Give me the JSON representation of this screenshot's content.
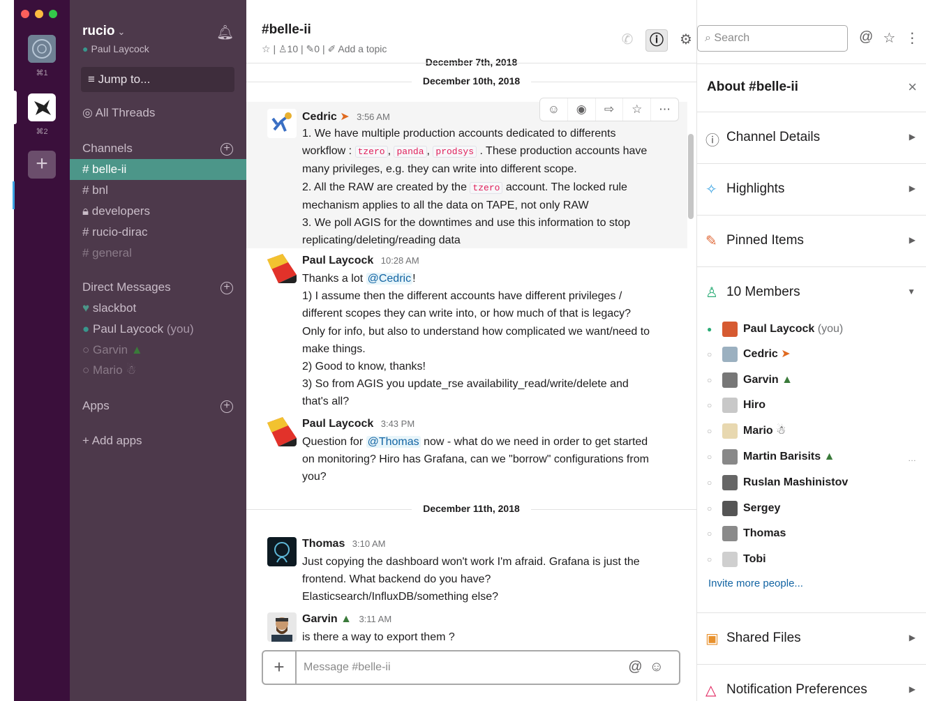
{
  "workspace": {
    "name": "rucio",
    "user": "Paul Laycock",
    "shortcut_1": "⌘1",
    "shortcut_2": "⌘2",
    "jump_to": "Jump to...",
    "all_threads": "All Threads"
  },
  "sidebar": {
    "channels_header": "Channels",
    "channels": [
      "# belle-ii",
      "# bnl",
      "developers",
      "# rucio-dirac",
      "# general"
    ],
    "dm_header": "Direct Messages",
    "dms": [
      "slackbot",
      "Paul Laycock",
      "(you)",
      "Garvin",
      "Mario"
    ],
    "apps_header": "Apps",
    "add_apps": "+ Add apps"
  },
  "channel": {
    "title": "#belle-ii",
    "members_count": "10",
    "pins_count": "0",
    "add_topic": "Add a topic"
  },
  "days": {
    "d1": "December 7th, 2018",
    "d2": "December 10th, 2018",
    "d3": "December 11th, 2018"
  },
  "messages": [
    {
      "author": "Cedric",
      "time": "3:56 AM",
      "lines": {
        "l1": "1. We have multiple production accounts dedicated to differents",
        "l2a": "workflow : ",
        "c1": "tzero",
        "c2": "panda",
        "c3": "prodsys",
        "l2b": ". These production accounts have",
        "l3": "many privileges, e.g. they can write into different scope.",
        "l4a": "2. All the RAW are created by the ",
        "c4": "tzero",
        "l4b": " account. The locked rule",
        "l5": "mechanism applies to all the data on TAPE, not only RAW",
        "l6": "3. We poll AGIS for the downtimes and use this information to stop",
        "l7": "replicating/deleting/reading data"
      }
    },
    {
      "author": "Paul Laycock",
      "time": "10:28 AM",
      "lines": {
        "l1a": "Thanks a lot ",
        "mention": "@Cedric",
        "l1b": "!",
        "l2": "1) I assume then the different accounts have different privileges /",
        "l3": "different scopes they can write into, or how much of that is legacy?",
        "l4": "Only for info, but also to understand how complicated we want/need to",
        "l5": "make things.",
        "l6": "2) Good to know, thanks!",
        "l7": "3) So from AGIS you update_rse availability_read/write/delete and",
        "l8": "that's all?"
      }
    },
    {
      "author": "Paul Laycock",
      "time": "3:43 PM",
      "lines": {
        "l1a": "Question for ",
        "mention": "@Thomas",
        "l1b": " now - what do we need in order to get started",
        "l2": "on monitoring?  Hiro has Grafana, can we \"borrow\" configurations from",
        "l3": "you?"
      }
    },
    {
      "author": "Thomas",
      "time": "3:10 AM",
      "lines": {
        "l1": "Just copying the dashboard won't work I'm afraid. Grafana is just the",
        "l2": "frontend. What backend do you have?",
        "l3": "Elasticsearch/InfluxDB/something else?"
      }
    },
    {
      "author": "Garvin",
      "time": "3:11 AM",
      "lines": {
        "l1": "is there a way to export them ?"
      }
    }
  ],
  "composer": {
    "placeholder": "Message #belle-ii"
  },
  "right_panel": {
    "search_placeholder": "Search",
    "title": "About #belle-ii",
    "sections": [
      "Channel Details",
      "Highlights",
      "Pinned Items",
      "10 Members",
      "Shared Files",
      "Notification Preferences"
    ],
    "members": [
      {
        "name": "Paul Laycock",
        "suffix": "(you)",
        "color": "#d65a31"
      },
      {
        "name": "Cedric",
        "suffix": "",
        "color": "#9bb0c0"
      },
      {
        "name": "Garvin",
        "suffix": "",
        "color": "#777777"
      },
      {
        "name": "Hiro",
        "suffix": "",
        "color": "#c8c8c8"
      },
      {
        "name": "Mario",
        "suffix": "",
        "color": "#e8d8b0"
      },
      {
        "name": "Martin Barisits",
        "suffix": "",
        "color": "#888888"
      },
      {
        "name": "Ruslan Mashinistov",
        "suffix": "",
        "color": "#666666"
      },
      {
        "name": "Sergey",
        "suffix": "",
        "color": "#555555"
      },
      {
        "name": "Thomas",
        "suffix": "",
        "color": "#8a8a8a"
      },
      {
        "name": "Tobi",
        "suffix": "",
        "color": "#cfcfcf"
      }
    ],
    "invite": "Invite more people..."
  }
}
